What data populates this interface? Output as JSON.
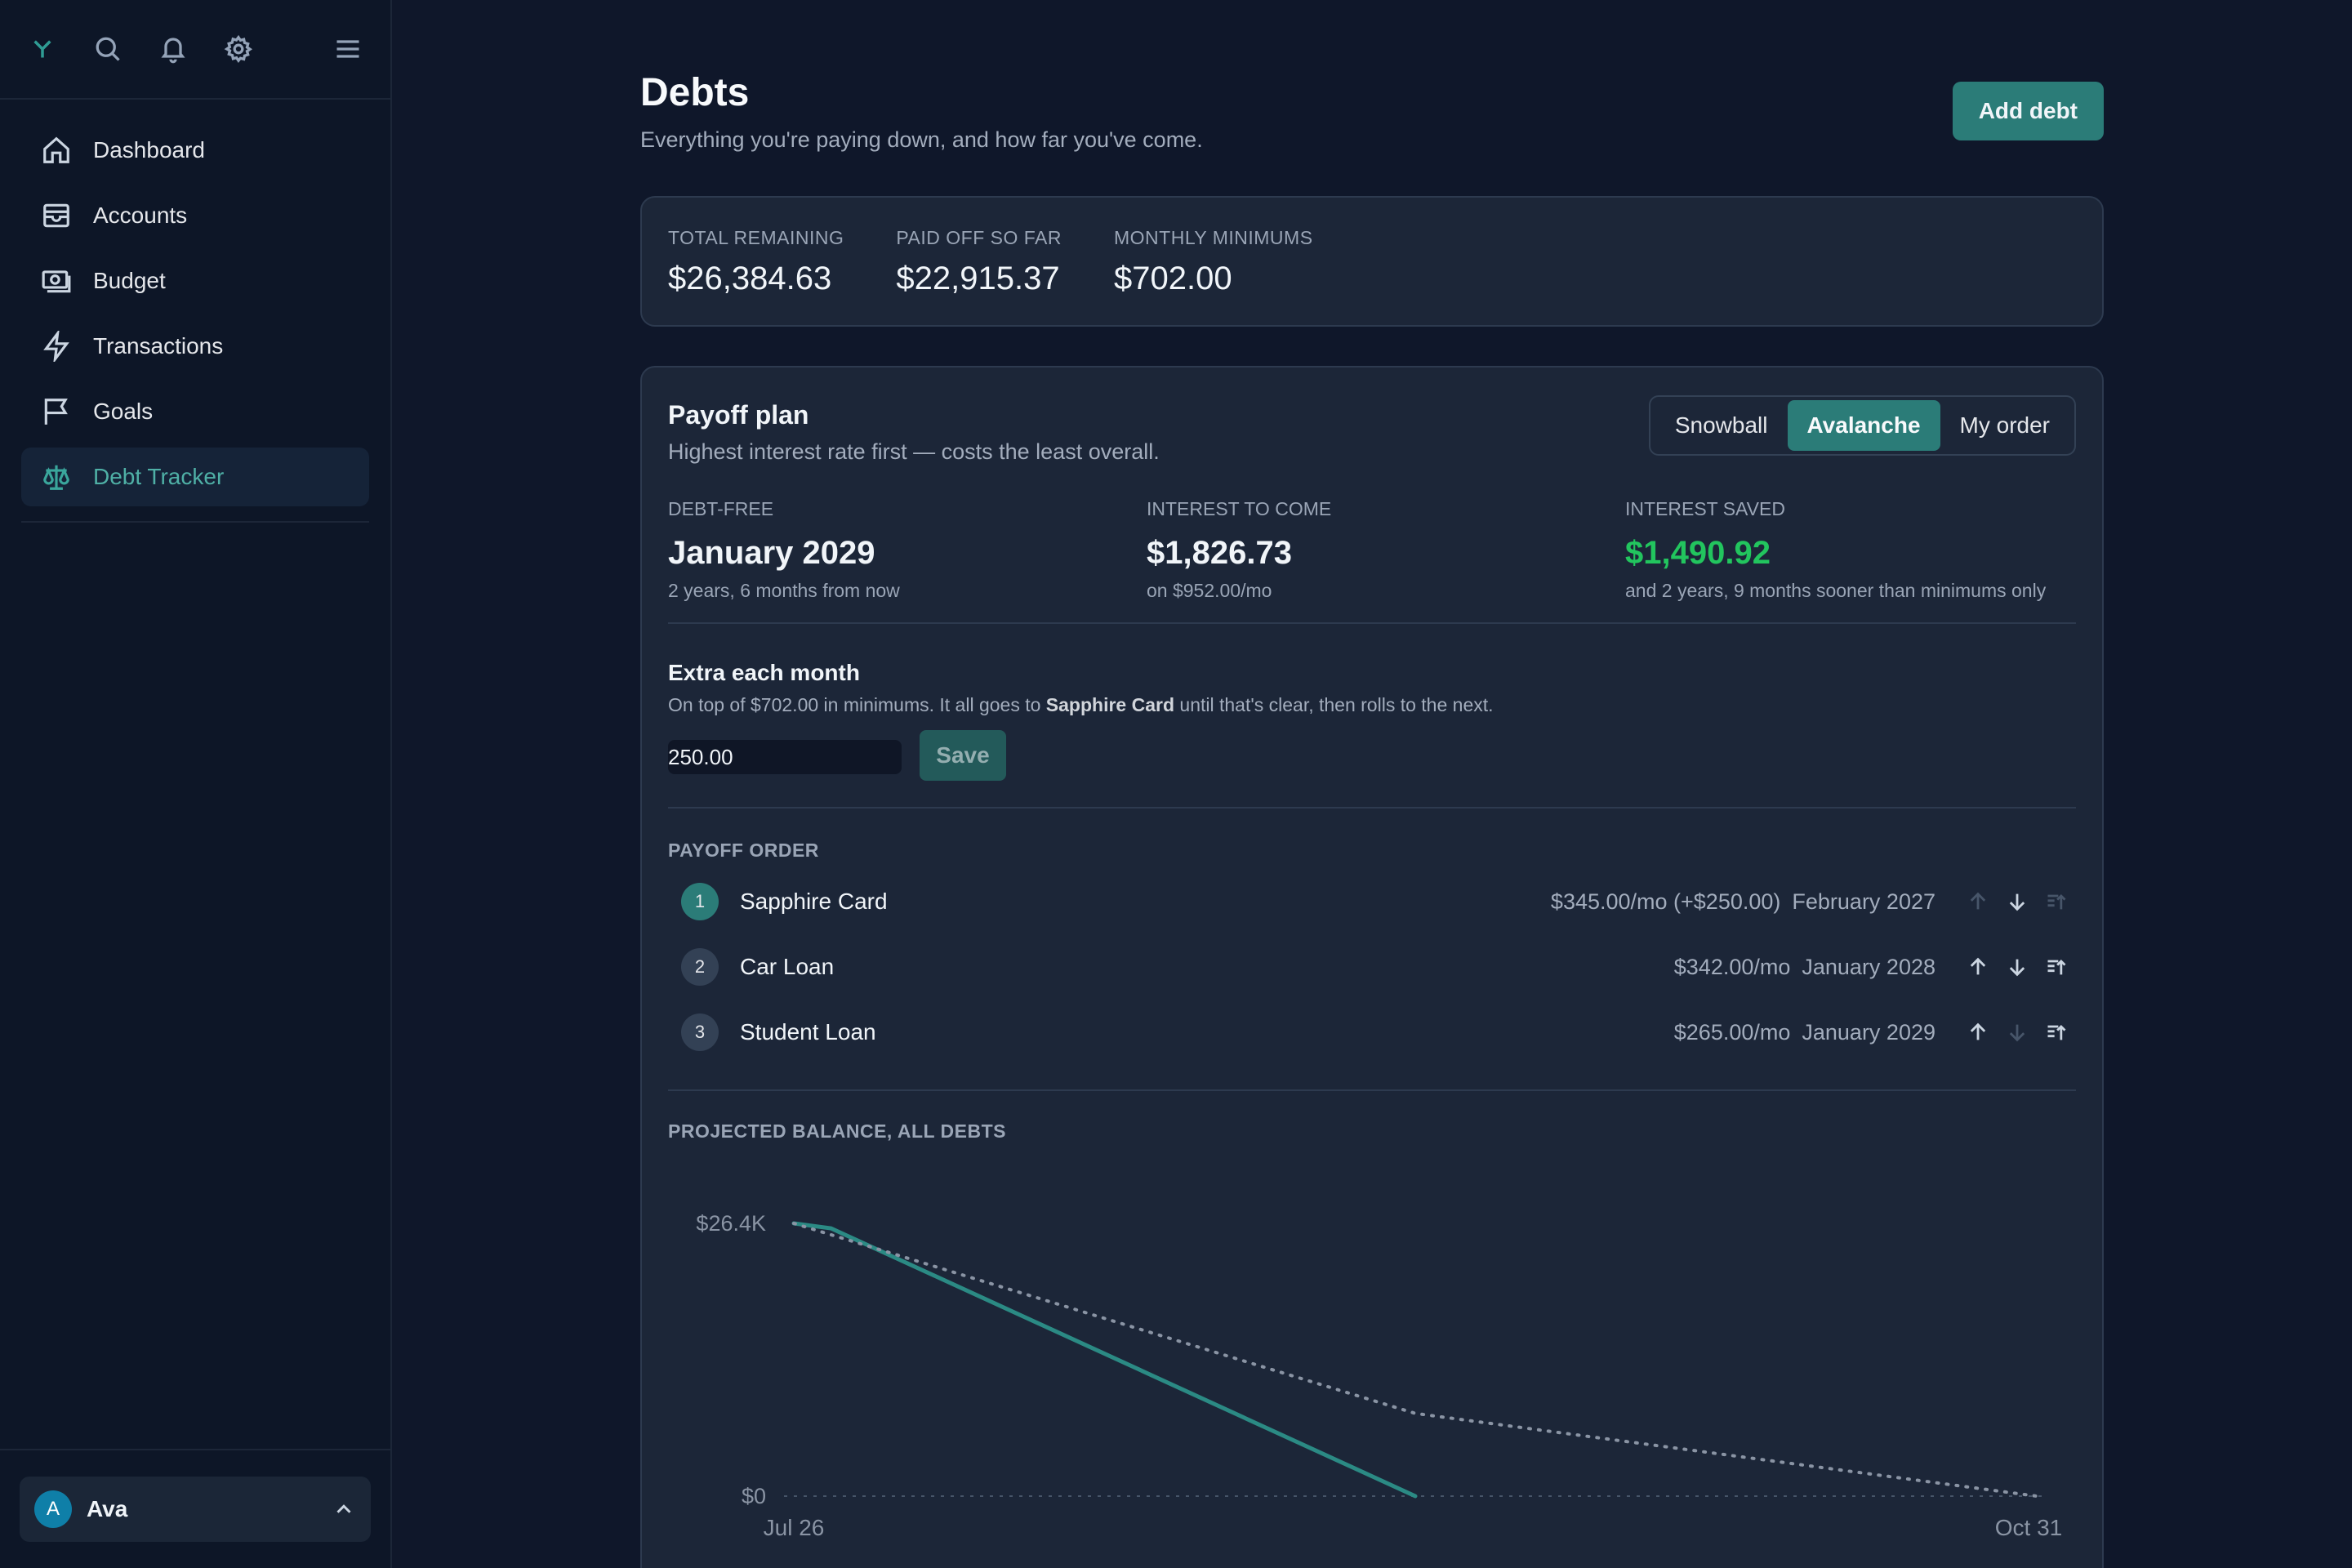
{
  "sidebar": {
    "icons": [
      "leaf-logo",
      "search-icon",
      "bell-icon",
      "gear-icon",
      "menu-icon"
    ],
    "items": [
      {
        "label": "Dashboard",
        "icon": "home-icon",
        "active": false
      },
      {
        "label": "Accounts",
        "icon": "wallet-icon",
        "active": false
      },
      {
        "label": "Budget",
        "icon": "banknote-icon",
        "active": false
      },
      {
        "label": "Transactions",
        "icon": "lightning-icon",
        "active": false
      },
      {
        "label": "Goals",
        "icon": "flag-icon",
        "active": false
      },
      {
        "label": "Debt Tracker",
        "icon": "scale-icon",
        "active": true
      }
    ],
    "user": {
      "initial": "A",
      "name": "Ava"
    }
  },
  "header": {
    "title": "Debts",
    "subtitle": "Everything you're paying down, and how far you've come.",
    "add_label": "Add debt"
  },
  "summary": {
    "stats": [
      {
        "label": "TOTAL REMAINING",
        "value": "$26,384.63"
      },
      {
        "label": "PAID OFF SO FAR",
        "value": "$22,915.37"
      },
      {
        "label": "MONTHLY MINIMUMS",
        "value": "$702.00"
      }
    ]
  },
  "plan": {
    "title": "Payoff plan",
    "description": "Highest interest rate first — costs the least overall.",
    "strategies": [
      "Snowball",
      "Avalanche",
      "My order"
    ],
    "selected_strategy": "Avalanche",
    "kpis": [
      {
        "label": "DEBT-FREE",
        "value": "January 2029",
        "note": "2 years, 6 months from now"
      },
      {
        "label": "INTEREST TO COME",
        "value": "$1,826.73",
        "note": "on $952.00/mo"
      },
      {
        "label": "INTEREST SAVED",
        "value": "$1,490.92",
        "note": "and 2 years, 9 months sooner than minimums only"
      }
    ],
    "extra": {
      "title": "Extra each month",
      "desc_prefix": "On top of $702.00 in minimums. It all goes to ",
      "desc_target": "Sapphire Card",
      "desc_suffix": " until that's clear, then rolls to the next.",
      "value": "250.00",
      "save_label": "Save"
    },
    "order_label": "PAYOFF ORDER",
    "order": [
      {
        "num": "1",
        "name": "Sapphire Card",
        "amount": "$345.00/mo (+$250.00)",
        "date": "February 2027",
        "up_enabled": false,
        "down_enabled": true,
        "top_enabled": false
      },
      {
        "num": "2",
        "name": "Car Loan",
        "amount": "$342.00/mo",
        "date": "January 2028",
        "up_enabled": true,
        "down_enabled": true,
        "top_enabled": true
      },
      {
        "num": "3",
        "name": "Student Loan",
        "amount": "$265.00/mo",
        "date": "January 2029",
        "up_enabled": true,
        "down_enabled": false,
        "top_enabled": true
      }
    ],
    "chart_label": "PROJECTED BALANCE, ALL DEBTS"
  },
  "colors": {
    "accent": "#2b7c78",
    "accent_text": "#4fb0a6",
    "positive": "#22c55e",
    "background": "#0f172a",
    "card": "#1c2638"
  },
  "chart_data": {
    "type": "line",
    "y_tick_labels": [
      "$26.4K",
      "$0"
    ],
    "x_tick_labels": [
      "Jul 26",
      "Oct 31"
    ],
    "ylim": [
      0,
      26384.63
    ],
    "series": [
      {
        "style": "solid",
        "color": "#2b8a84",
        "points": [
          [
            0,
            26384.63
          ],
          [
            0.03,
            25900
          ],
          [
            0.5,
            0
          ]
        ]
      },
      {
        "style": "dotted",
        "color": "#8a94a4",
        "points": [
          [
            0,
            26384.63
          ],
          [
            0.5,
            8000
          ],
          [
            1.0,
            0
          ]
        ]
      }
    ],
    "zero_line": true,
    "grid": false,
    "legend": "none"
  }
}
